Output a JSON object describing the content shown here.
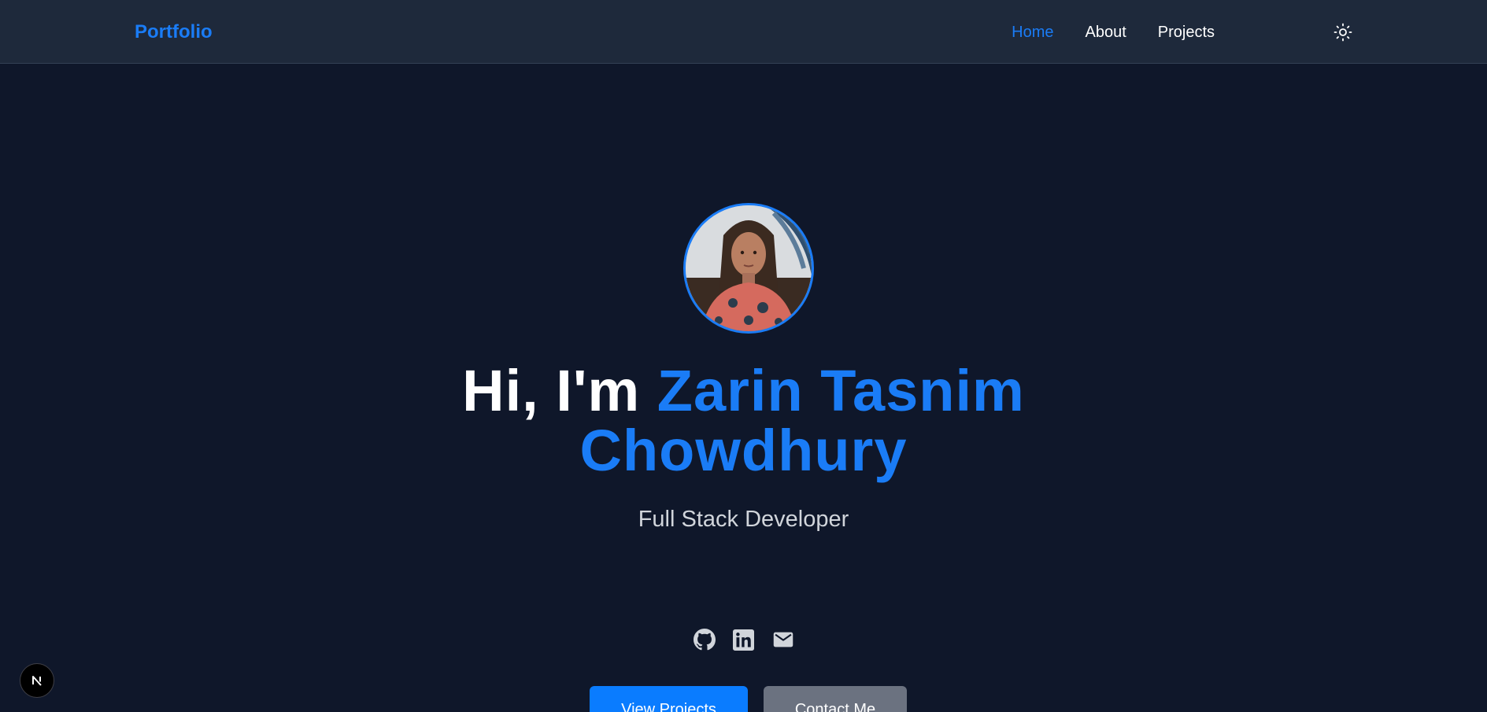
{
  "navbar": {
    "brand": "Portfolio",
    "links": [
      {
        "label": "Home",
        "active": true
      },
      {
        "label": "About",
        "active": false
      },
      {
        "label": "Projects",
        "active": false
      }
    ],
    "theme_toggle_icon": "sun-icon"
  },
  "hero": {
    "avatar_icon": "profile-photo",
    "greeting": "Hi, I'm ",
    "name_line1": "Zarin Tasnim",
    "name_line2": "Chowdhury",
    "role": "Full Stack Developer",
    "socials": [
      {
        "icon": "github-icon"
      },
      {
        "icon": "linkedin-icon"
      },
      {
        "icon": "email-icon"
      }
    ],
    "primary_button": "View Projects",
    "secondary_button": "Contact Me"
  },
  "dev_badge": {
    "label": "N",
    "icon": "nextjs-icon"
  },
  "colors": {
    "background": "#0f172a",
    "navbar": "#1e293b",
    "accent": "#1a7cf6",
    "primary_button": "#0a7cff",
    "secondary_button": "#6b7280",
    "subtitle": "#d1d5db"
  }
}
